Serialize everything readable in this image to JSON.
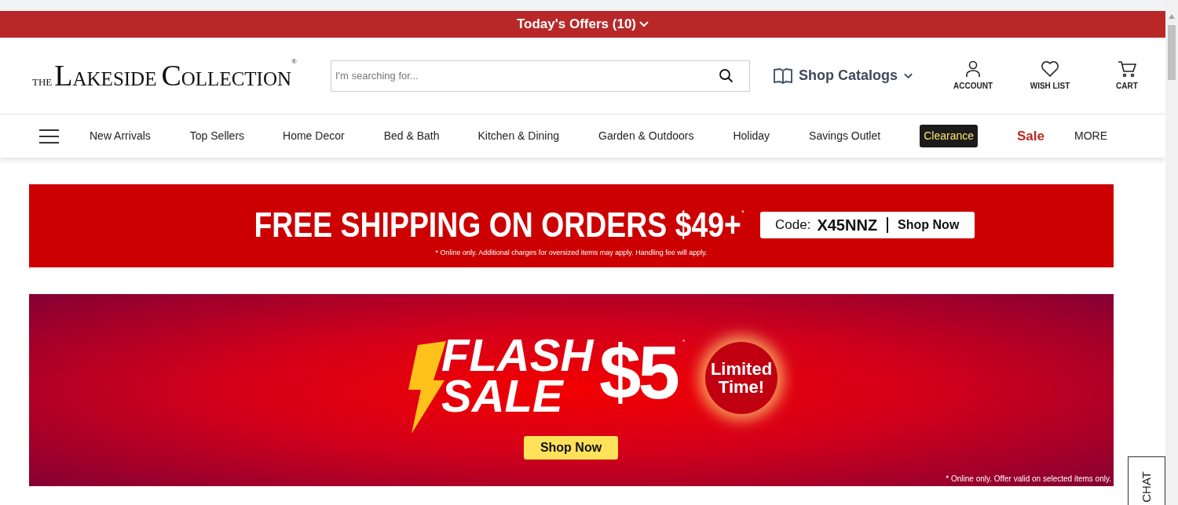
{
  "offers_bar": {
    "label": "Today's Offers (10)"
  },
  "header": {
    "logo": {
      "the": "THE",
      "l": "L",
      "akeside": "AKESIDE",
      "c": "C",
      "ollection": "OLLECTION",
      "reg": "®"
    },
    "search": {
      "placeholder": "I'm searching for..."
    },
    "catalogs": "Shop Catalogs",
    "actions": [
      {
        "kind": "account",
        "label": "ACCOUNT"
      },
      {
        "kind": "wishlist",
        "label": "WISH LIST"
      },
      {
        "kind": "cart",
        "label": "CART"
      }
    ]
  },
  "nav": [
    {
      "kind": "link",
      "label": "New Arrivals"
    },
    {
      "kind": "link",
      "label": "Top Sellers"
    },
    {
      "kind": "link",
      "label": "Home Decor"
    },
    {
      "kind": "link",
      "label": "Bed & Bath"
    },
    {
      "kind": "link",
      "label": "Kitchen & Dining"
    },
    {
      "kind": "link",
      "label": "Garden & Outdoors"
    },
    {
      "kind": "link",
      "label": "Holiday"
    },
    {
      "kind": "link",
      "label": "Savings Outlet"
    },
    {
      "kind": "clearance",
      "label": "Clearance"
    },
    {
      "kind": "sale",
      "label": "Sale"
    },
    {
      "kind": "more",
      "label": "MORE"
    }
  ],
  "shipping_banner": {
    "headline": "FREE SHIPPING ON ORDERS $49+",
    "mark": "*",
    "code_label": "Code:",
    "code": "X45NNZ",
    "cta": "Shop Now",
    "note": "* Online only. Additional charges for oversized items may apply. Handling fee will apply."
  },
  "flash_banner": {
    "line_1": "FLASH",
    "line_2": "SALE",
    "price": "$5",
    "mark": "*",
    "badge_1": "Limited",
    "badge_2": "Time!",
    "cta": "Shop Now",
    "note": "* Online only. Offer valid on selected items only."
  },
  "chat": {
    "label": "CHAT"
  }
}
